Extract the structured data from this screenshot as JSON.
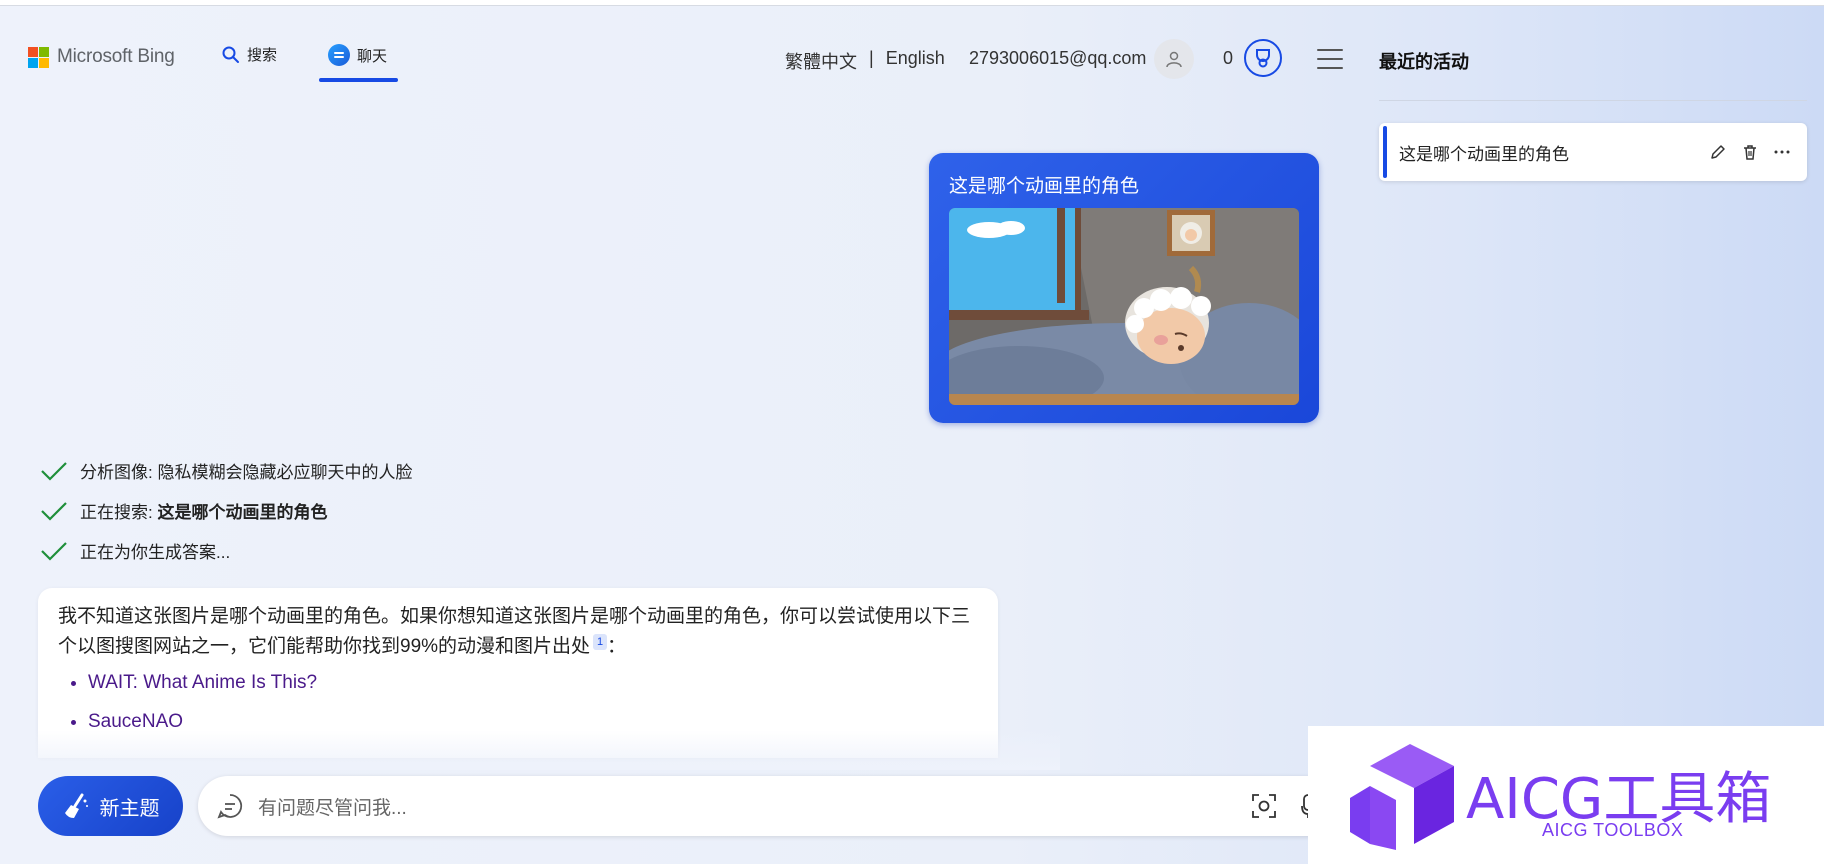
{
  "header": {
    "brand": "Microsoft Bing",
    "nav": [
      {
        "label": "搜索",
        "icon": "search-icon"
      },
      {
        "label": "聊天",
        "icon": "chat-icon",
        "active": true
      }
    ],
    "lang_traditional": "繁體中文",
    "lang_separator": "|",
    "lang_english": "English",
    "email": "2793006015@qq.com",
    "points": "0"
  },
  "recent": {
    "title": "最近的活动",
    "items": [
      {
        "label": "这是哪个动画里的角色"
      }
    ]
  },
  "user_message": {
    "text": "这是哪个动画里的角色",
    "image": "cartoon elderly sheep character sleeping in bed"
  },
  "steps": [
    {
      "label": "分析图像: 隐私模糊会隐藏必应聊天中的人脸",
      "bold": ""
    },
    {
      "label": "正在搜索: ",
      "bold": "这是哪个动画里的角色"
    },
    {
      "label": "正在为你生成答案...",
      "bold": ""
    }
  ],
  "answer": {
    "paragraph": "我不知道这张图片是哪个动画里的角色。如果你想知道这张图片是哪个动画里的角色，你可以尝试使用以下三个以图搜图网站之一，它们能帮助你找到99%的动漫和图片出处",
    "citation": "1",
    "trailing": "：",
    "links": [
      "WAIT: What Anime Is This?",
      "SauceNAO"
    ]
  },
  "composer": {
    "new_topic": "新主题",
    "placeholder": "有问题尽管问我..."
  },
  "watermark": {
    "title": "AICG工具箱",
    "subtitle": "AICG TOOLBOX"
  },
  "colors": {
    "accent": "#174ae4",
    "link": "#4a1a8a",
    "watermark": "#7a3df0",
    "check": "#1f8f3a"
  }
}
